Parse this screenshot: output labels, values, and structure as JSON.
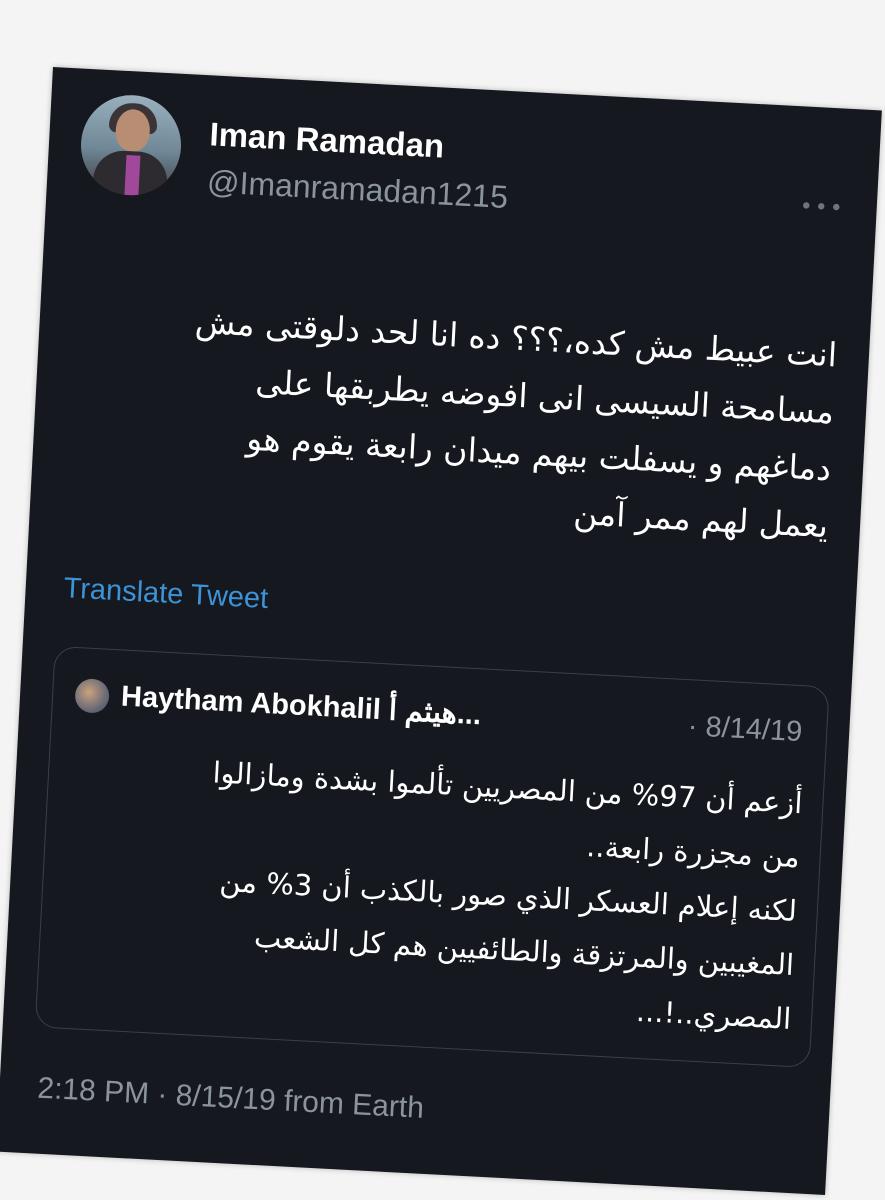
{
  "tweet": {
    "author": {
      "display_name": "Iman Ramadan",
      "handle": "@Imanramadan1215"
    },
    "more_icon": "more-dots-icon",
    "text_lines": [
      "انت عبيط مش كده،؟؟؟ ده انا لحد دلوقتى مش",
      "مسامحة السيسى انى افوضه يطربقها على",
      "دماغهم و يسفلت بيهم ميدان رابعة يقوم هو",
      "يعمل لهم ممر آمن"
    ],
    "translate_label": "Translate Tweet",
    "timestamp": "2:18 PM · 8/15/19 from Earth"
  },
  "quoted_tweet": {
    "author_name": "Haytham Abokhalil هيثم أ...",
    "date": "· 8/14/19",
    "text_lines": [
      "أزعم أن 97% من المصريين تألموا بشدة ومازالوا",
      "من مجزرة رابعة..",
      "لكنه إعلام العسكر الذي صور بالكذب أن 3% من",
      "المغيبين والمرتزقة والطائفيين هم كل الشعب",
      "المصري..!..."
    ]
  },
  "colors": {
    "card_background": "#15181e",
    "text_primary": "#ffffff",
    "text_secondary": "#8b949e",
    "link": "#3c93d8",
    "quote_border": "#3a3f46"
  }
}
